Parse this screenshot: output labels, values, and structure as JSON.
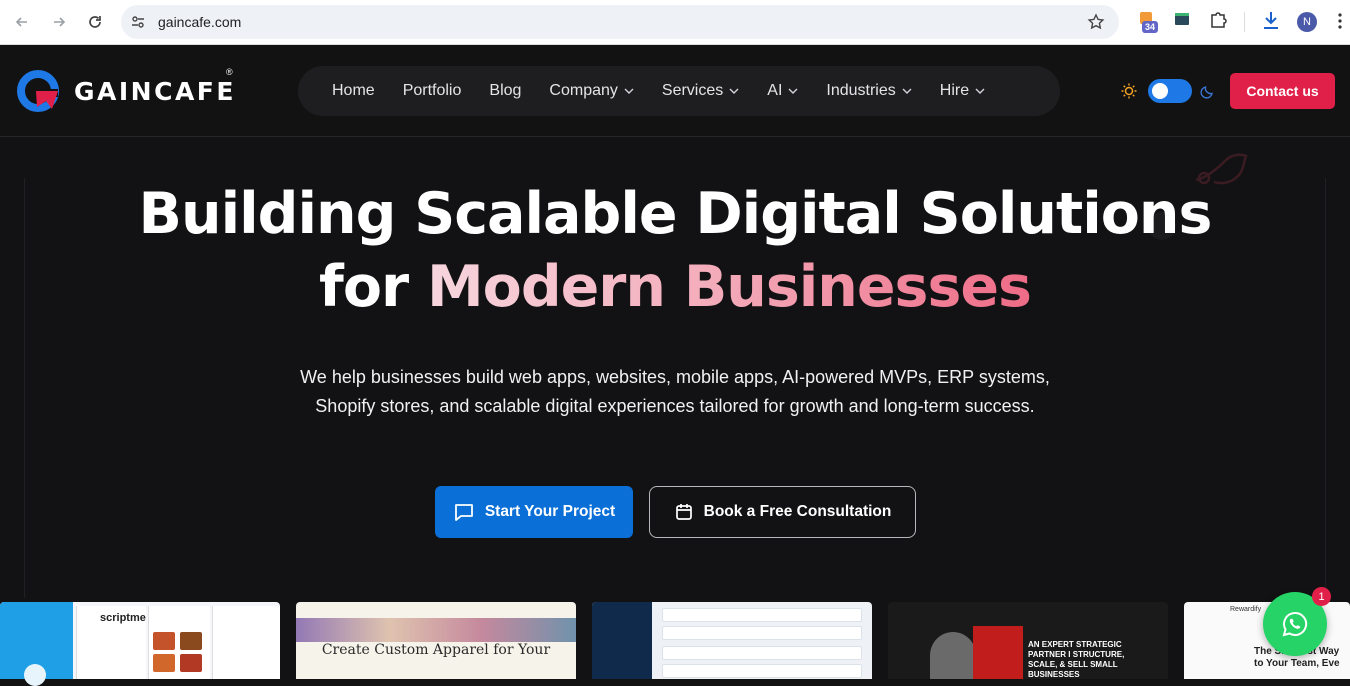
{
  "browser": {
    "url": "gaincafe.com",
    "extension_badge": "34",
    "profile_initial": "N"
  },
  "header": {
    "logo_text": "GAINCAFE",
    "logo_reg": "®",
    "nav": [
      {
        "label": "Home",
        "dropdown": false
      },
      {
        "label": "Portfolio",
        "dropdown": false
      },
      {
        "label": "Blog",
        "dropdown": false
      },
      {
        "label": "Company",
        "dropdown": true
      },
      {
        "label": "Services",
        "dropdown": true
      },
      {
        "label": "AI",
        "dropdown": true
      },
      {
        "label": "Industries",
        "dropdown": true
      },
      {
        "label": "Hire",
        "dropdown": true
      }
    ],
    "contact_label": "Contact us"
  },
  "hero": {
    "title_line1": "Building Scalable Digital Solutions",
    "title_line2_prefix": "for ",
    "title_line2_highlight": "Modern Businesses",
    "subtitle": "We help businesses build web apps, websites, mobile apps, AI-powered MVPs, ERP systems, Shopify stores, and scalable digital experiences tailored for growth and long-term success.",
    "primary_cta": "Start Your Project",
    "secondary_cta": "Book a Free Consultation"
  },
  "portfolio": {
    "card1_brand": "scriptme",
    "card2_title": "Create Custom Apparel for Your",
    "card4_text": "AN EXPERT STRATEGIC PARTNER I STRUCTURE, SCALE, & SELL SMALL BUSINESSES",
    "card5_brand": "Rewardify",
    "card5_title": "The Simplest Way to Your Team, Eve"
  },
  "whatsapp": {
    "badge_count": "1"
  },
  "colors": {
    "accent_red": "#e1204a",
    "primary_blue": "#0a6fd6",
    "background": "#121212"
  }
}
